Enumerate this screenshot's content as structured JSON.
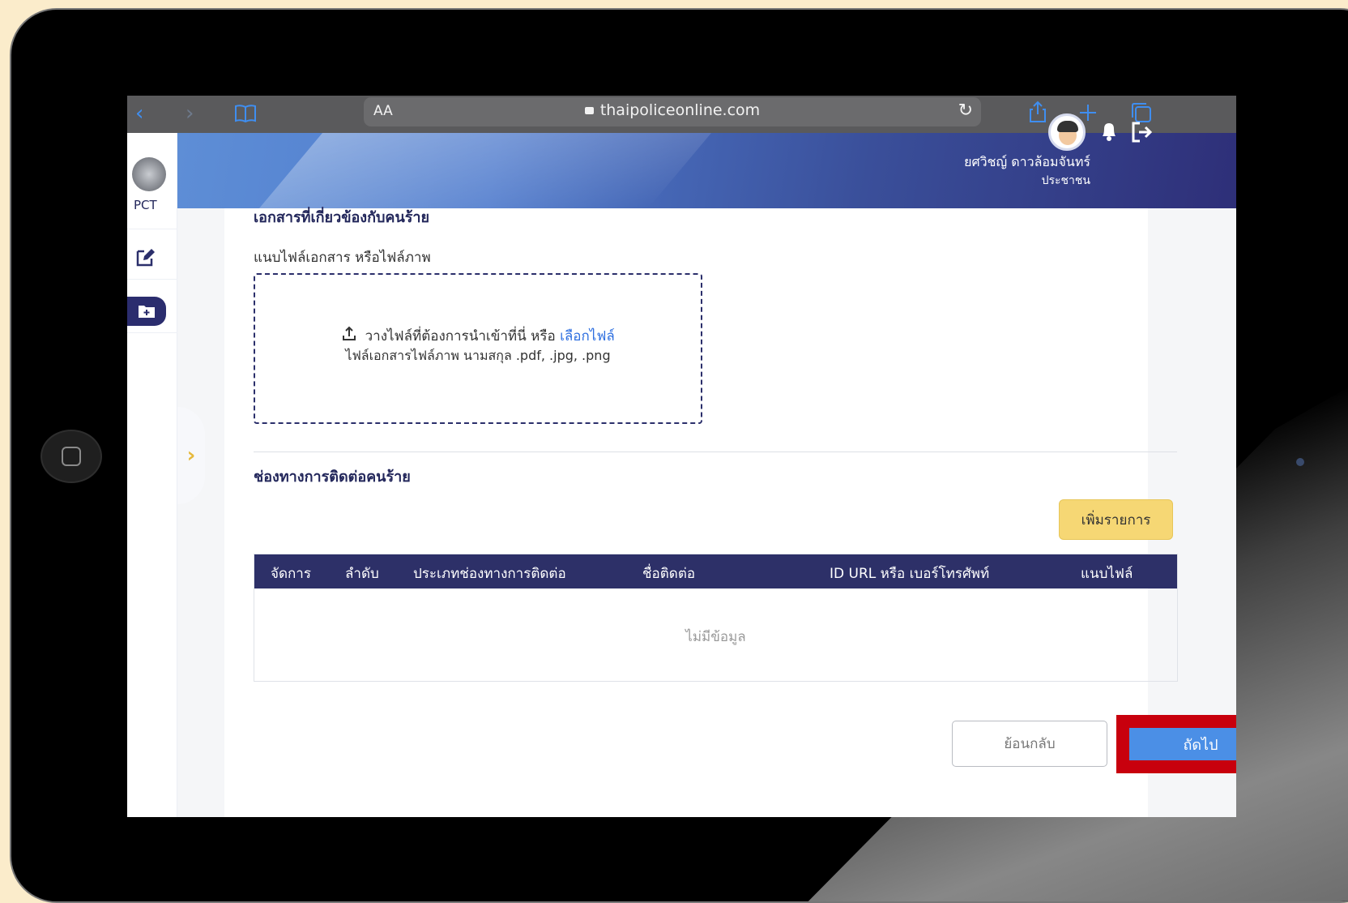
{
  "browser": {
    "text_size_label": "AA",
    "url": "thaipoliceonline.com"
  },
  "header": {
    "user_name": "ยศวิชญ์ ดาวล้อมจันทร์",
    "user_role": "ประชาชน"
  },
  "sidebar": {
    "logo_label": "PCT"
  },
  "content": {
    "section_title_partial": "เอกสารที่เกี่ยวข้องกับคนร้าย",
    "attach_label": "แนบไฟล์เอกสาร หรือไฟล์ภาพ",
    "dropzone_text": "วางไฟล์ที่ต้องการนำเข้าที่นี่ หรือ",
    "dropzone_link": "เลือกไฟล์",
    "dropzone_hint": "ไฟล์เอกสารไฟล์ภาพ นามสกุล .pdf, .jpg, .png",
    "contact_section_title": "ช่องทางการติดต่อคนร้าย",
    "add_button": "เพิ่มรายการ",
    "table_headers": [
      "จัดการ",
      "ลำดับ",
      "ประเภทช่องทางการติดต่อ",
      "ชื่อติดต่อ",
      "ID URL หรือ เบอร์โทรศัพท์",
      "แนบไฟล์"
    ],
    "empty_text": "ไม่มีข้อมูล",
    "back_button": "ย้อนกลับ",
    "next_button": "ถัดไป"
  },
  "colors": {
    "header_dark": "#2e2f78",
    "table_header": "#2d3068",
    "primary_button": "#4b8fe6",
    "add_button": "#f6d774",
    "highlight": "#c8000d"
  }
}
